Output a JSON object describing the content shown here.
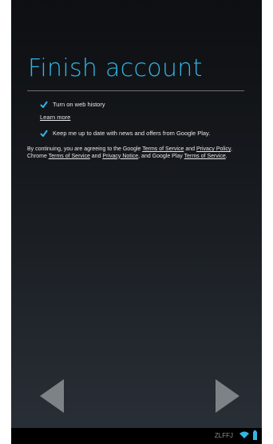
{
  "screen": {
    "title": "Finish account"
  },
  "options": {
    "web_history_label": "Turn on web history",
    "learn_more_label": "Learn more",
    "updates_label": "Keep me up to date with news and offers from Google Play."
  },
  "terms": {
    "intro": "By continuing, you are agreeing to the Google ",
    "google_tos": "Terms of Service",
    "and1": " and ",
    "google_privacy": "Privacy Policy",
    "chrome_prefix": ", Chrome ",
    "chrome_tos": "Terms of Service",
    "and2": " and ",
    "chrome_privacy": "Privacy Notice",
    "play_prefix": ", and Google Play ",
    "play_tos": "Terms of Service",
    "end": "."
  },
  "status_bar": {
    "text": "ZLFFJ"
  },
  "colors": {
    "accent": "#33b5e5",
    "nav_arrow": "#7d8287"
  }
}
